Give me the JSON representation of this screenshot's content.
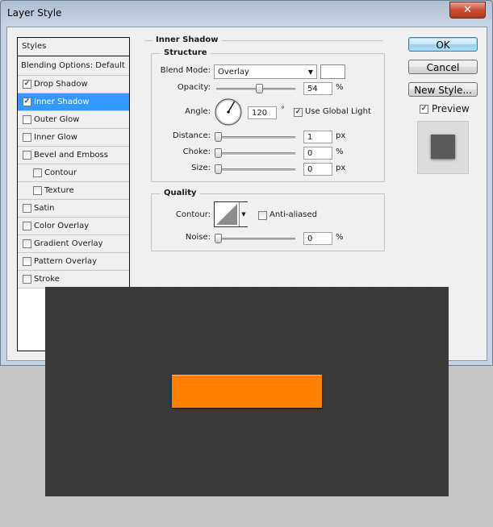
{
  "window": {
    "title": "Layer Style",
    "close_glyph": "✕"
  },
  "styles_panel": {
    "header": "Styles",
    "items": [
      {
        "label": "Blending Options: Default",
        "kind": "plain",
        "checked": false,
        "selected": false,
        "indent": false
      },
      {
        "label": "Drop Shadow",
        "kind": "check",
        "checked": true,
        "selected": false,
        "indent": false
      },
      {
        "label": "Inner Shadow",
        "kind": "check",
        "checked": true,
        "selected": true,
        "indent": false
      },
      {
        "label": "Outer Glow",
        "kind": "check",
        "checked": false,
        "selected": false,
        "indent": false
      },
      {
        "label": "Inner Glow",
        "kind": "check",
        "checked": false,
        "selected": false,
        "indent": false
      },
      {
        "label": "Bevel and Emboss",
        "kind": "check",
        "checked": false,
        "selected": false,
        "indent": false
      },
      {
        "label": "Contour",
        "kind": "check",
        "checked": false,
        "selected": false,
        "indent": true
      },
      {
        "label": "Texture",
        "kind": "check",
        "checked": false,
        "selected": false,
        "indent": true
      },
      {
        "label": "Satin",
        "kind": "check",
        "checked": false,
        "selected": false,
        "indent": false
      },
      {
        "label": "Color Overlay",
        "kind": "check",
        "checked": false,
        "selected": false,
        "indent": false
      },
      {
        "label": "Gradient Overlay",
        "kind": "check",
        "checked": false,
        "selected": false,
        "indent": false
      },
      {
        "label": "Pattern Overlay",
        "kind": "check",
        "checked": false,
        "selected": false,
        "indent": false
      },
      {
        "label": "Stroke",
        "kind": "check",
        "checked": false,
        "selected": false,
        "indent": false
      }
    ]
  },
  "inner_shadow": {
    "section_title": "Inner Shadow",
    "structure": {
      "title": "Structure",
      "blend_mode_label": "Blend Mode:",
      "blend_mode_value": "Overlay",
      "blend_color": "#ffffff",
      "opacity_label": "Opacity:",
      "opacity_value": "54",
      "opacity_unit": "%",
      "opacity_level": 0.54,
      "angle_label": "Angle:",
      "angle_value": "120",
      "angle_unit": "°",
      "use_global_light_label": "Use Global Light",
      "use_global_light_checked": true,
      "distance_label": "Distance:",
      "distance_value": "1",
      "distance_unit": "px",
      "choke_label": "Choke:",
      "choke_value": "0",
      "choke_unit": "%",
      "size_label": "Size:",
      "size_value": "0",
      "size_unit": "px"
    },
    "quality": {
      "title": "Quality",
      "contour_label": "Contour:",
      "anti_aliased_label": "Anti-aliased",
      "anti_aliased_checked": false,
      "noise_label": "Noise:",
      "noise_value": "0",
      "noise_unit": "%"
    }
  },
  "buttons": {
    "ok": "OK",
    "cancel": "Cancel",
    "new_style": "New Style...",
    "preview_label": "Preview",
    "preview_checked": true
  },
  "canvas": {
    "background": "#3a3a3a",
    "shape_color": "#ff7f00"
  }
}
